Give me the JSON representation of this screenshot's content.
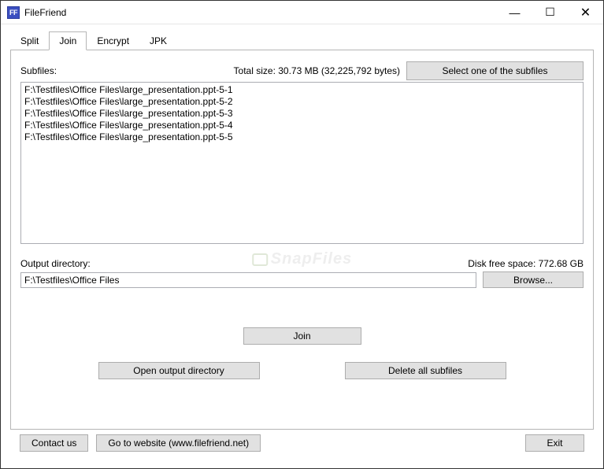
{
  "window": {
    "title": "FileFriend",
    "icon_text": "FF"
  },
  "tabs": {
    "items": [
      "Split",
      "Join",
      "Encrypt",
      "JPK"
    ],
    "active_index": 1
  },
  "panel": {
    "subfiles_label": "Subfiles:",
    "total_size": "Total size: 30.73 MB (32,225,792 bytes)",
    "select_button": "Select one of the subfiles",
    "files": [
      "F:\\Testfiles\\Office Files\\large_presentation.ppt-5-1",
      "F:\\Testfiles\\Office Files\\large_presentation.ppt-5-2",
      "F:\\Testfiles\\Office Files\\large_presentation.ppt-5-3",
      "F:\\Testfiles\\Office Files\\large_presentation.ppt-5-4",
      "F:\\Testfiles\\Office Files\\large_presentation.ppt-5-5"
    ],
    "output_label": "Output directory:",
    "disk_free": "Disk free space: 772.68 GB",
    "output_value": "F:\\Testfiles\\Office Files",
    "browse": "Browse...",
    "join": "Join",
    "open_output": "Open output directory",
    "delete_all": "Delete all subfiles"
  },
  "footer": {
    "contact": "Contact us",
    "website": "Go to website (www.filefriend.net)",
    "exit": "Exit"
  },
  "watermark": "SnapFiles"
}
